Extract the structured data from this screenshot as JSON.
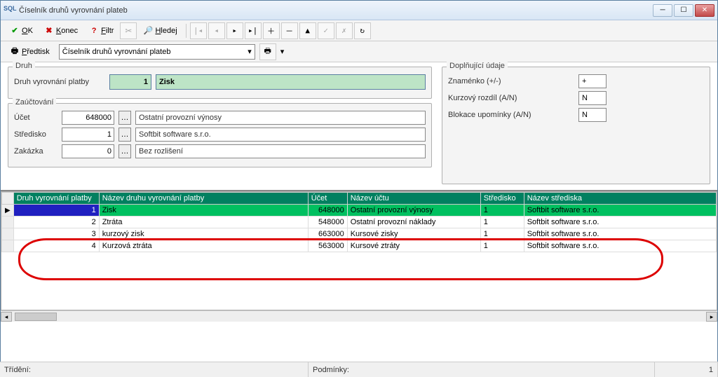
{
  "window": {
    "title": "Číselník druhů vyrovnání plateb"
  },
  "toolbar": {
    "ok": "OK",
    "konec": "Konec",
    "filtr": "Filtr",
    "hledej": "Hledej",
    "predtisk": "Předtisk"
  },
  "combo": {
    "value": "Číselník druhů vyrovnání plateb"
  },
  "druh": {
    "legend": "Druh",
    "label": "Druh vyrovnání platby",
    "id": "1",
    "name": "Zisk"
  },
  "zauctovani": {
    "legend": "Zaúčtování",
    "ucet_label": "Účet",
    "ucet": "648000",
    "ucet_name": "Ostatní provozní výnosy",
    "stredisko_label": "Středisko",
    "stredisko": "1",
    "stredisko_name": "Softbit software s.r.o.",
    "zakazka_label": "Zakázka",
    "zakazka": "0",
    "zakazka_name": "Bez rozlišení"
  },
  "doplnujici": {
    "legend": "Doplňující údaje",
    "znamenko_label": "Znaménko (+/-)",
    "znamenko": "+",
    "kurz_label": "Kurzový rozdíl (A/N)",
    "kurz": "N",
    "blokace_label": "Blokace upomínky (A/N)",
    "blokace": "N"
  },
  "grid": {
    "headers": {
      "druh": "Druh vyrovnání platby",
      "nazev": "Název druhu vyrovnání platby",
      "ucet": "Účet",
      "nazev_uctu": "Název účtu",
      "stredisko": "Středisko",
      "nazev_strediska": "Název střediska"
    },
    "rows": [
      {
        "druh": "1",
        "nazev": "Zisk",
        "ucet": "648000",
        "nazev_uctu": "Ostatní provozní výnosy",
        "stredisko": "1",
        "nazev_strediska": "Softbit software s.r.o."
      },
      {
        "druh": "2",
        "nazev": "Ztráta",
        "ucet": "548000",
        "nazev_uctu": "Ostatní provozní náklady",
        "stredisko": "1",
        "nazev_strediska": "Softbit software s.r.o."
      },
      {
        "druh": "3",
        "nazev": "kurzový zisk",
        "ucet": "663000",
        "nazev_uctu": "Kursové zisky",
        "stredisko": "1",
        "nazev_strediska": "Softbit software s.r.o."
      },
      {
        "druh": "4",
        "nazev": "Kurzová ztráta",
        "ucet": "563000",
        "nazev_uctu": "Kursové ztráty",
        "stredisko": "1",
        "nazev_strediska": "Softbit software s.r.o."
      }
    ]
  },
  "statusbar": {
    "trideni": "Třídění:",
    "podminky": "Podmínky:",
    "count": "1"
  }
}
